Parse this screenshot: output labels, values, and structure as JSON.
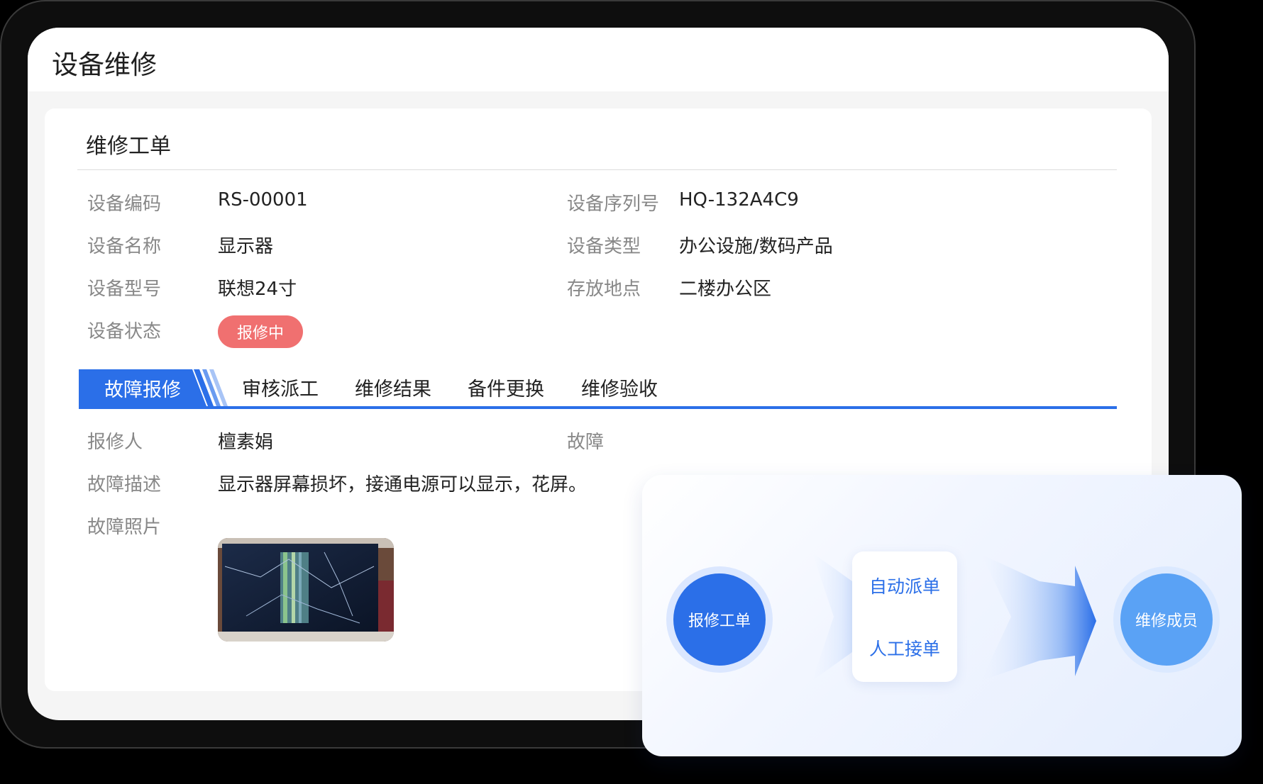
{
  "page": {
    "title": "设备维修"
  },
  "card": {
    "title": "维修工单",
    "fields_left": [
      {
        "label": "设备编码",
        "value": "RS-00001"
      },
      {
        "label": "设备名称",
        "value": "显示器"
      },
      {
        "label": "设备型号",
        "value": "联想24寸"
      },
      {
        "label": "设备状态",
        "value": "报修中"
      }
    ],
    "fields_right": [
      {
        "label": "设备序列号",
        "value": "HQ-132A4C9"
      },
      {
        "label": "设备类型",
        "value": "办公设施/数码产品"
      },
      {
        "label": "存放地点",
        "value": "二楼办公区"
      }
    ],
    "status_color": "#f07070"
  },
  "tabs": [
    {
      "label": "故障报修",
      "active": true
    },
    {
      "label": "审核派工"
    },
    {
      "label": "维修结果"
    },
    {
      "label": "备件更换"
    },
    {
      "label": "维修验收"
    }
  ],
  "repair": {
    "reporter_label": "报修人",
    "reporter_value": "檀素娟",
    "partial_label": "故障",
    "description_label": "故障描述",
    "description_value": "显示器屏幕损坏，接通电源可以显示，花屏。",
    "photo_label": "故障照片"
  },
  "flow": {
    "start": "报修工单",
    "options": [
      "自动派单",
      "人工接单"
    ],
    "end": "维修成员"
  },
  "colors": {
    "accent": "#2b6fe8",
    "accent_light": "#5aa2f5"
  }
}
